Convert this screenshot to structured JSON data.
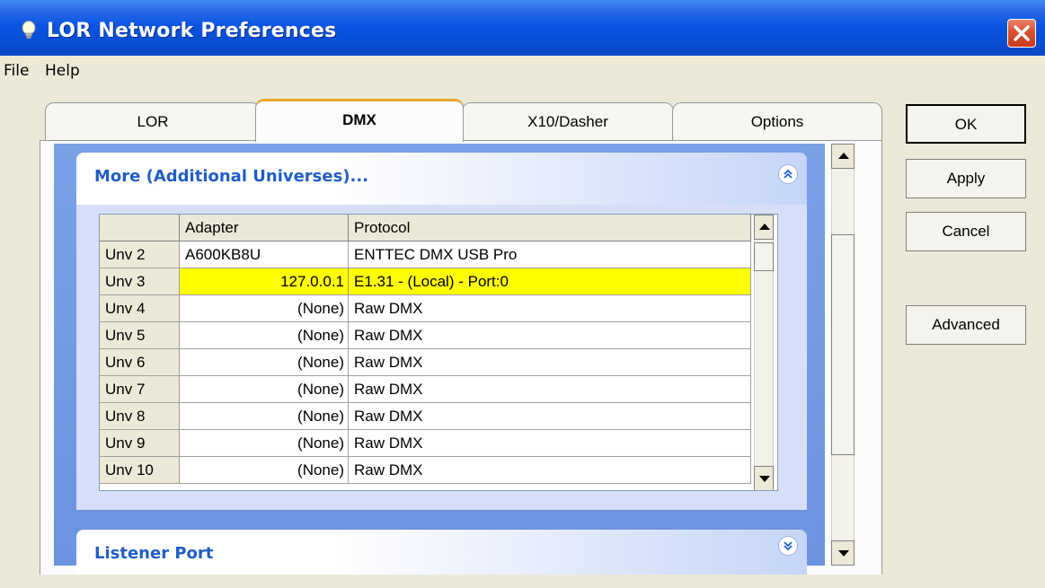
{
  "window": {
    "title": "LOR Network Preferences"
  },
  "menu": {
    "items": [
      "File",
      "Help"
    ]
  },
  "tabs": [
    {
      "label": "LOR",
      "active": false
    },
    {
      "label": "DMX",
      "active": true
    },
    {
      "label": "X10/Dasher",
      "active": false
    },
    {
      "label": "Options",
      "active": false
    }
  ],
  "buttons": {
    "ok": "OK",
    "apply": "Apply",
    "cancel": "Cancel",
    "advanced": "Advanced"
  },
  "groups": {
    "more": {
      "title": "More (Additional Universes)...",
      "state": "expanded"
    },
    "listener": {
      "title": "Listener Port",
      "state": "collapsed"
    }
  },
  "grid": {
    "columns": [
      "",
      "Adapter",
      "Protocol"
    ],
    "rows": [
      {
        "universe": "Unv 2",
        "adapter": "A600KB8U",
        "protocol": "ENTTEC DMX USB Pro",
        "highlight": false
      },
      {
        "universe": "Unv 3",
        "adapter": "127.0.0.1",
        "protocol": "E1.31 - (Local) - Port:0",
        "highlight": true
      },
      {
        "universe": "Unv 4",
        "adapter": "(None)",
        "protocol": "Raw DMX",
        "highlight": false
      },
      {
        "universe": "Unv 5",
        "adapter": "(None)",
        "protocol": "Raw DMX",
        "highlight": false
      },
      {
        "universe": "Unv 6",
        "adapter": "(None)",
        "protocol": "Raw DMX",
        "highlight": false
      },
      {
        "universe": "Unv 7",
        "adapter": "(None)",
        "protocol": "Raw DMX",
        "highlight": false
      },
      {
        "universe": "Unv 8",
        "adapter": "(None)",
        "protocol": "Raw DMX",
        "highlight": false
      },
      {
        "universe": "Unv 9",
        "adapter": "(None)",
        "protocol": "Raw DMX",
        "highlight": false
      },
      {
        "universe": "Unv 10",
        "adapter": "(None)",
        "protocol": "Raw DMX",
        "highlight": false
      }
    ]
  },
  "colors": {
    "title_bar": "#0a4fd6",
    "highlight_row": "#ffff00",
    "group_title": "#215dc6",
    "pane": "#6b93df"
  },
  "icons": {
    "app": "lightbulb-icon",
    "close": "close-icon",
    "collapse": "chevron-up-double-icon",
    "expand": "chevron-down-double-icon"
  }
}
